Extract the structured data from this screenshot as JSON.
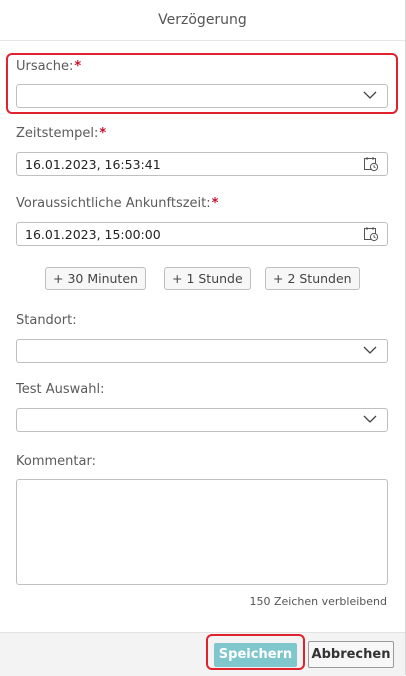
{
  "dialog": {
    "title": "Verzögerung",
    "fields": {
      "cause": {
        "label": "Ursache:",
        "required_mark": "*",
        "value": ""
      },
      "timestamp": {
        "label": "Zeitstempel:",
        "required_mark": "*",
        "value": "16.01.2023, 16:53:41"
      },
      "eta": {
        "label": "Voraussichtliche Ankunftszeit:",
        "required_mark": "*",
        "value": "16.01.2023, 15:00:00"
      },
      "location": {
        "label": "Standort:",
        "value": ""
      },
      "test_select": {
        "label": "Test Auswahl:",
        "value": ""
      },
      "comment": {
        "label": "Kommentar:",
        "value": "",
        "remaining": "150 Zeichen verbleibend"
      }
    },
    "quick_buttons": [
      "+ 30 Minuten",
      "+ 1 Stunde",
      "+ 2 Stunden"
    ],
    "footer": {
      "save_label": "Speichern",
      "cancel_label": "Abbrechen"
    }
  },
  "colors": {
    "required": "#c8102e",
    "highlight": "#e0222f",
    "save_bg": "#7fc6cd"
  },
  "icons": {
    "dropdown": "chevron-down-icon",
    "date": "calendar-clock-icon"
  }
}
